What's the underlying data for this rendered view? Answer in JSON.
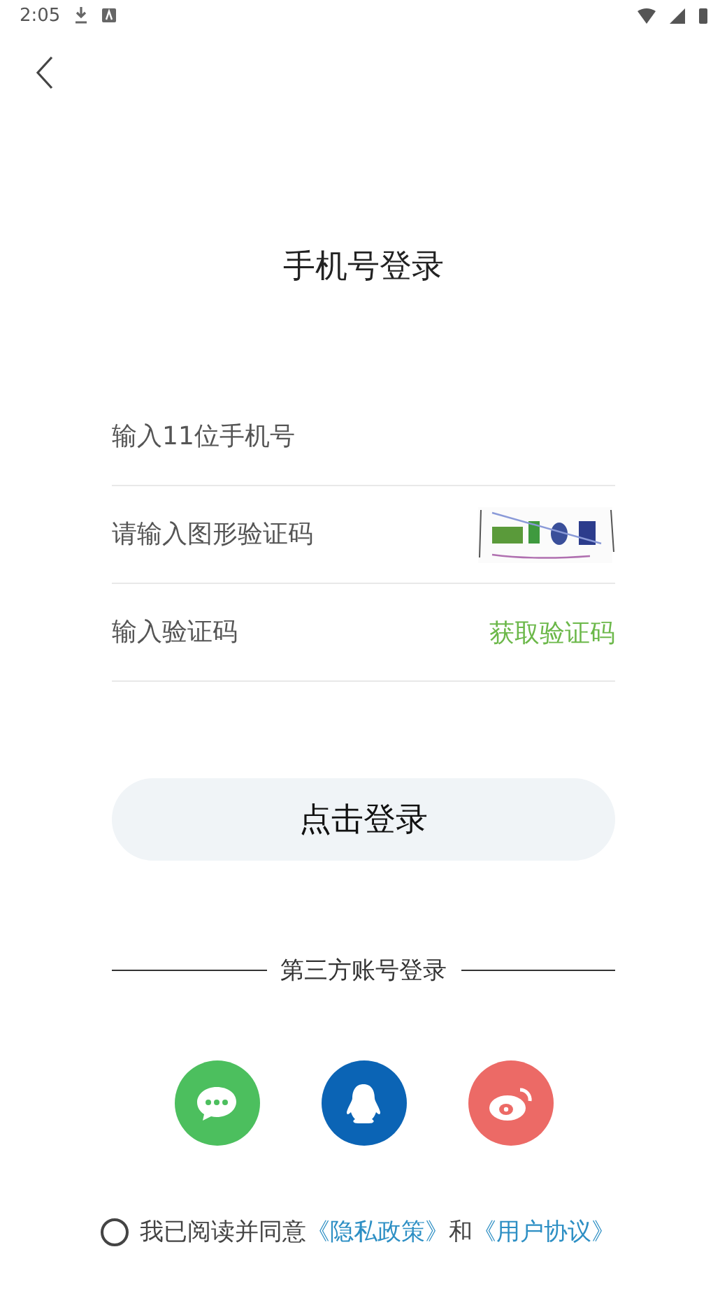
{
  "status_bar": {
    "time": "2:05"
  },
  "title": "手机号登录",
  "fields": [
    {
      "kind": "plain",
      "placeholder": "输入11位手机号"
    },
    {
      "kind": "captcha",
      "placeholder": "请输入图形验证码"
    },
    {
      "kind": "code",
      "placeholder": "输入验证码",
      "action": "获取验证码"
    }
  ],
  "login_button": "点击登录",
  "third_party": {
    "heading": "第三方账号登录",
    "options": [
      {
        "kind": "chat",
        "color": "#4cbf5e"
      },
      {
        "kind": "penguin",
        "color": "#0b64b5"
      },
      {
        "kind": "weibo",
        "color": "#ec6a66"
      }
    ]
  },
  "agreement": {
    "checked": false,
    "text": "我已阅读并同意",
    "links": [
      "《隐私政策》",
      "《用户协议》"
    ],
    "joiner": "和"
  }
}
